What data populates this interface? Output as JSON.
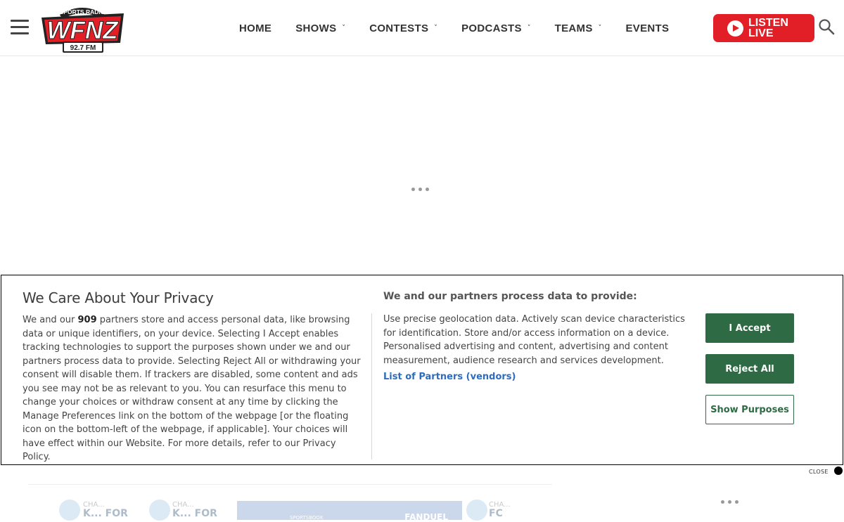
{
  "header": {
    "logo": {
      "top_text": "SPORTS RADIO",
      "main_text": "WFNZ",
      "freq_text": "92.7 FM",
      "colors": {
        "red": "#e21e26",
        "dark": "#222222"
      }
    },
    "nav": [
      {
        "label": "HOME",
        "has_dropdown": false
      },
      {
        "label": "SHOWS",
        "has_dropdown": true
      },
      {
        "label": "CONTESTS",
        "has_dropdown": true
      },
      {
        "label": "PODCASTS",
        "has_dropdown": true
      },
      {
        "label": "TEAMS",
        "has_dropdown": true
      },
      {
        "label": "EVENTS",
        "has_dropdown": false
      }
    ],
    "dropdown_glyph": "˅",
    "listen_live": {
      "line1": "LISTEN",
      "line2": "LIVE",
      "color": "#e21e26"
    },
    "icons": {
      "menu": "hamburger-menu-icon",
      "search": "search-icon",
      "play": "play-icon"
    }
  },
  "consent": {
    "title": "We Care About Your Privacy",
    "body_pre": "We and our ",
    "partner_count": "909",
    "body_post": " partners store and access personal data, like browsing data or unique identifiers, on your device. Selecting I Accept enables tracking technologies to support the purposes shown under we and our partners process data to provide. Selecting Reject All or withdrawing your consent will disable them. If trackers are disabled, some content and ads you see may not be as relevant to you. You can resurface this menu to change your choices or withdraw consent at any time by clicking the Manage Preferences link on the bottom of the webpage [or the floating icon on the bottom-left of the webpage, if applicable]. Your choices will have effect within our Website. For more details, refer to our Privacy Policy.",
    "purposes_title": "We and our partners process data to provide:",
    "purposes_text": "Use precise geolocation data. Actively scan device characteristics for identification. Store and/or access information on a device. Personalised advertising and content, advertising and content measurement, audience research and services development.",
    "partners_link": "List of Partners (vendors)",
    "buttons": {
      "accept": "I Accept",
      "reject": "Reject All",
      "purposes": "Show Purposes"
    },
    "close_label": "CLOSE",
    "accent_color": "#2e6b45",
    "link_color": "#2d6cbf"
  },
  "ad_strip": {
    "items": [
      {
        "small": "CHA...",
        "big": "K...   FOR"
      },
      {
        "small": "CHA...",
        "big": "K...   FOR"
      },
      {
        "small": "CHA...",
        "big": "FC"
      }
    ],
    "banner_brand": "FANDUEL",
    "banner_left": "SPORTSBOOK"
  }
}
